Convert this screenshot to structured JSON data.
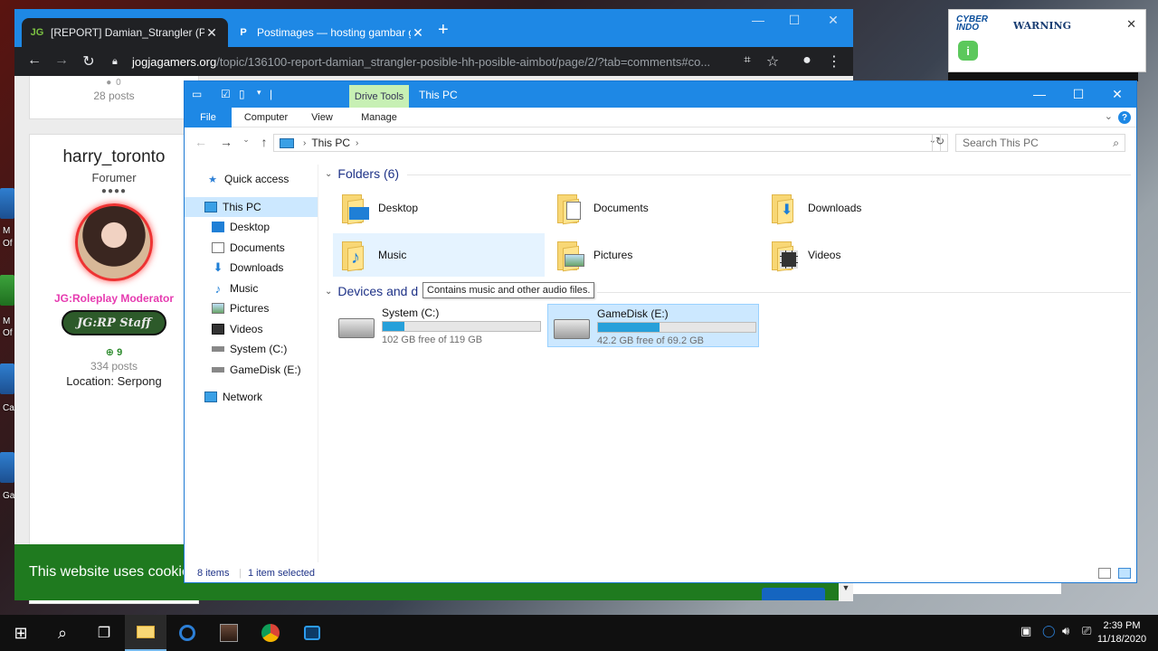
{
  "desktop": {
    "icon_labels": [
      "M",
      "Of",
      "M",
      "Of",
      "Ca",
      "Ga"
    ]
  },
  "chrome": {
    "tabs": [
      {
        "icon": "jg-favicon",
        "title": "[REPORT] Damian_Strangler (Posi",
        "active": true
      },
      {
        "icon": "postimages-favicon",
        "title": "Postimages — hosting gambar g",
        "active": false
      }
    ],
    "url_domain": "jogjagamers.org",
    "url_path": "/topic/136100-report-damian_strangler-posible-hh-posible-aimbot/page/2/?tab=comments#co...",
    "prev_card": {
      "rep": "0",
      "posts": "28 posts"
    },
    "profile": {
      "username": "harry_toronto",
      "rank": "Forumer",
      "rank_pips": "●●●●",
      "group_title": "JG:Roleplay Moderator",
      "badge_text": "JG:RP Staff",
      "reputation": "9",
      "posts": "334 posts",
      "location": "Location: Serpong"
    },
    "cookie_text": "This website uses cookie"
  },
  "explorer": {
    "title": "This PC",
    "context_tab": "Drive Tools",
    "ribbon_tabs": [
      "File",
      "Computer",
      "View",
      "Manage"
    ],
    "address": "This PC",
    "search_placeholder": "Search This PC",
    "nav": {
      "quick_access": "Quick access",
      "this_pc": "This PC",
      "items": [
        "Desktop",
        "Documents",
        "Downloads",
        "Music",
        "Pictures",
        "Videos",
        "System (C:)",
        "GameDisk (E:)"
      ],
      "network": "Network"
    },
    "folders_header": "Folders (6)",
    "folders": [
      "Desktop",
      "Documents",
      "Downloads",
      "Music",
      "Pictures",
      "Videos"
    ],
    "devices_header": "Devices and d",
    "tooltip": "Contains music and other audio files.",
    "drives": [
      {
        "name": "System (C:)",
        "free": "102 GB free of 119 GB",
        "used_fraction": 0.14
      },
      {
        "name": "GameDisk (E:)",
        "free": "42.2 GB free of 69.2 GB",
        "used_fraction": 0.39
      }
    ],
    "status": {
      "items": "8 items",
      "selected": "1 item selected"
    }
  },
  "cyber": {
    "logo_line1": "CYBER",
    "logo_line2": "INDO",
    "warning": "WARNING"
  },
  "taskbar": {
    "time": "2:39 PM",
    "date": "11/18/2020"
  },
  "colors": {
    "chrome_frame": "#1e88e5",
    "explorer_title": "#1e88e5",
    "cookie_bar": "#1f7a1f",
    "moderator_pink": "#e63bb0",
    "selection": "#cce8ff",
    "drive_fill": "#26a0da"
  }
}
